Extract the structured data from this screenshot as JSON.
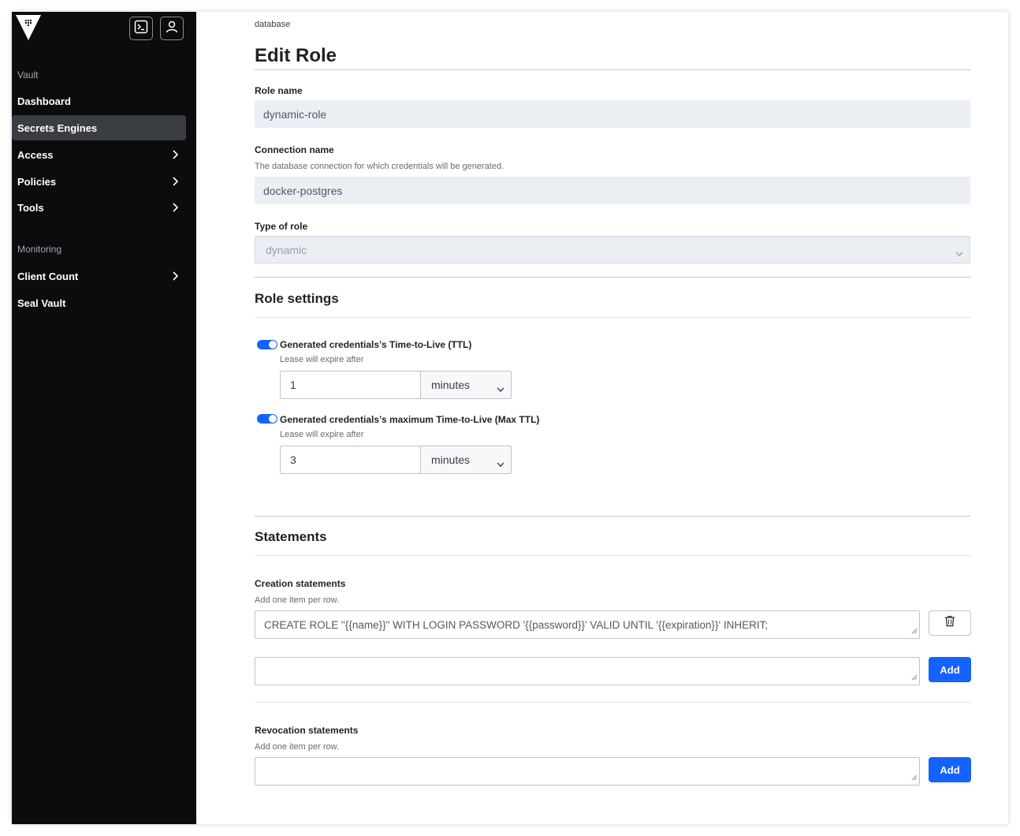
{
  "sidebar": {
    "sections": [
      {
        "heading": "Vault",
        "items": [
          {
            "label": "Dashboard"
          },
          {
            "label": "Secrets Engines",
            "active": true
          },
          {
            "label": "Access",
            "chevron": true
          },
          {
            "label": "Policies",
            "chevron": true
          },
          {
            "label": "Tools",
            "chevron": true
          }
        ]
      },
      {
        "heading": "Monitoring",
        "items": [
          {
            "label": "Client Count",
            "chevron": true
          },
          {
            "label": "Seal Vault"
          }
        ]
      }
    ],
    "header_icons": [
      "terminal-icon",
      "user-icon"
    ]
  },
  "breadcrumb": "database",
  "page_title": "Edit Role",
  "form": {
    "role_name": {
      "label": "Role name",
      "value": "dynamic-role"
    },
    "connection_name": {
      "label": "Connection name",
      "help": "The database connection for which credentials will be generated.",
      "value": "docker-postgres"
    },
    "role_type": {
      "label": "Type of role",
      "value": "dynamic"
    }
  },
  "role_settings": {
    "title": "Role settings",
    "ttl": {
      "label": "Generated credentials’s Time-to-Live (TTL)",
      "help": "Lease will expire after",
      "enabled": true,
      "value": "1",
      "unit": "minutes"
    },
    "max_ttl": {
      "label": "Generated credentials’s maximum Time-to-Live (Max TTL)",
      "help": "Lease will expire after",
      "enabled": true,
      "value": "3",
      "unit": "minutes"
    }
  },
  "statements": {
    "title": "Statements",
    "creation": {
      "label": "Creation statements",
      "help": "Add one item per row.",
      "items": [
        "CREATE ROLE \"{{name}}\" WITH LOGIN PASSWORD '{{password}}' VALID UNTIL '{{expiration}}' INHERIT;"
      ],
      "new_value": "",
      "add_label": "Add"
    },
    "revocation": {
      "label": "Revocation statements",
      "help": "Add one item per row.",
      "new_value": "",
      "add_label": "Add"
    }
  },
  "colors": {
    "sidebar_bg": "#0c0c0e",
    "active_item_bg": "#3b3d45",
    "accent": "#1563ff",
    "readonly_field_bg": "#ebeef2"
  }
}
